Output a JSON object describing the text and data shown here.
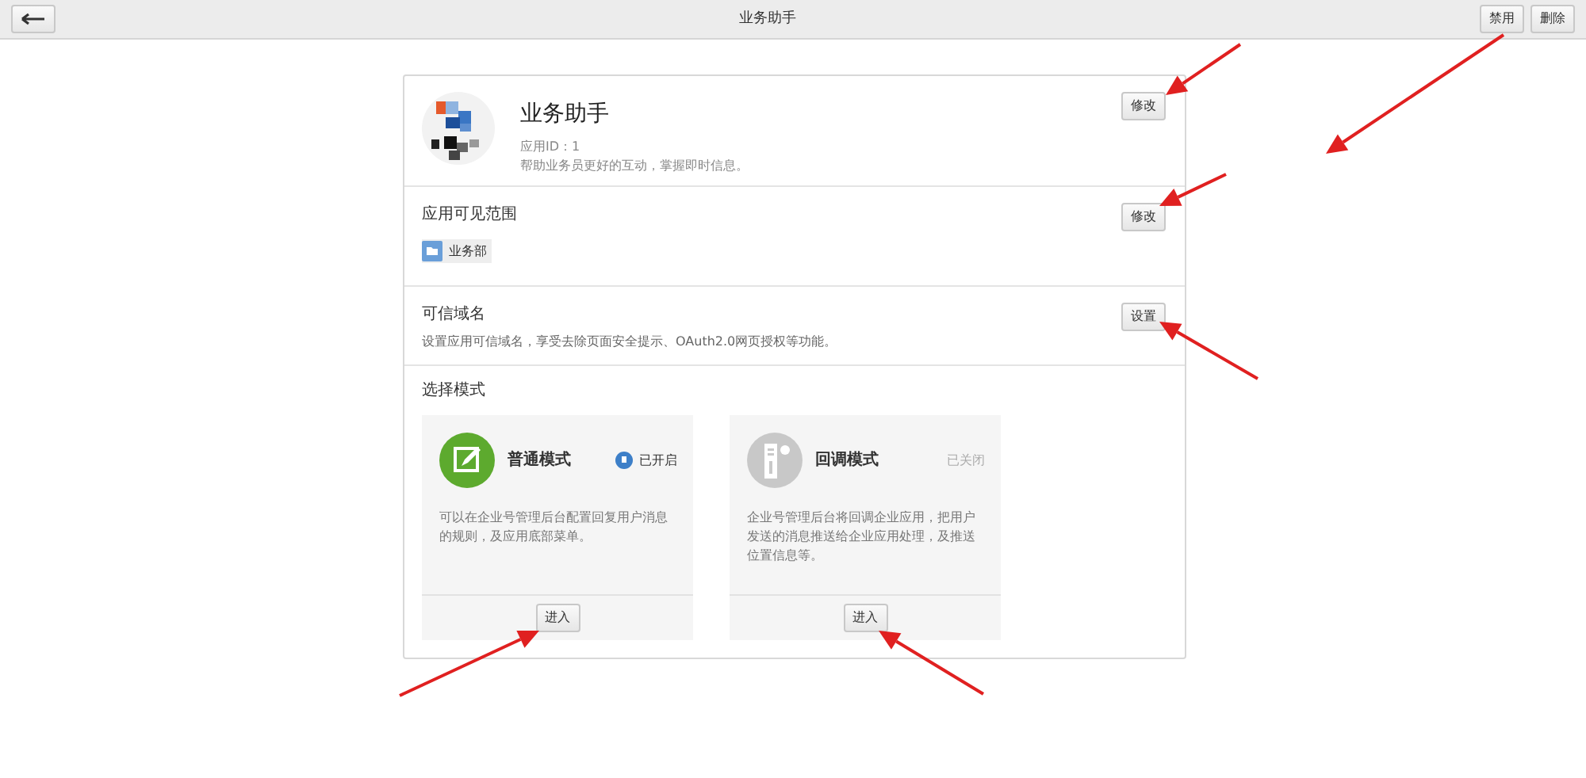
{
  "topbar": {
    "title": "业务助手",
    "buttons": [
      "禁用",
      "删除"
    ]
  },
  "app": {
    "name": "业务助手",
    "id_label": "应用ID：1",
    "description": "帮助业务员更好的互动，掌握即时信息。",
    "button": "修改"
  },
  "scope": {
    "title": "应用可见范围",
    "button": "修改",
    "tags": [
      "业务部"
    ]
  },
  "domain": {
    "title": "可信域名",
    "description": "设置应用可信域名，享受去除页面安全提示、OAuth2.0网页授权等功能。",
    "button": "设置"
  },
  "modes": {
    "title": "选择模式",
    "items": [
      {
        "kind": "normal",
        "name": "普通模式",
        "status": "已开启",
        "enabled": true,
        "description": "可以在企业号管理后台配置回复用户消息的规则，及应用底部菜单。",
        "button": "进入"
      },
      {
        "kind": "callback",
        "name": "回调模式",
        "status": "已关闭",
        "enabled": false,
        "description": "企业号管理后台将回调企业应用，把用户发送的消息推送给企业应用处理，及推送位置信息等。",
        "button": "进入"
      }
    ]
  }
}
